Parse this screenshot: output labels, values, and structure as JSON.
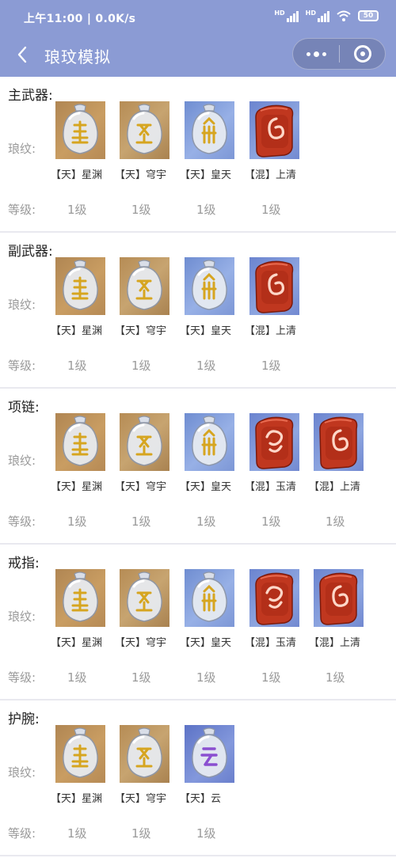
{
  "status": {
    "time": "上午11:00 | 0.0K/s",
    "hd1": "HD",
    "hd2": "HD",
    "battery": "50"
  },
  "nav": {
    "title": "琅玟模拟"
  },
  "labels": {
    "wen": "琅纹:",
    "level": "等级:"
  },
  "sections": [
    {
      "title": "主武器:",
      "items": [
        {
          "name": "【天】星渊",
          "level": "1级",
          "icon": "xingyuan-rune-icon"
        },
        {
          "name": "【天】穹宇",
          "level": "1级",
          "icon": "qiongyu-rune-icon"
        },
        {
          "name": "【天】皇天",
          "level": "1级",
          "icon": "huangtian-rune-icon"
        },
        {
          "name": "【混】上清",
          "level": "1级",
          "icon": "shangqing-rune-icon"
        }
      ]
    },
    {
      "title": "副武器:",
      "items": [
        {
          "name": "【天】星渊",
          "level": "1级",
          "icon": "xingyuan-rune-icon"
        },
        {
          "name": "【天】穹宇",
          "level": "1级",
          "icon": "qiongyu-rune-icon"
        },
        {
          "name": "【天】皇天",
          "level": "1级",
          "icon": "huangtian-rune-icon"
        },
        {
          "name": "【混】上清",
          "level": "1级",
          "icon": "shangqing-rune-icon"
        }
      ]
    },
    {
      "title": "项链:",
      "items": [
        {
          "name": "【天】星渊",
          "level": "1级",
          "icon": "xingyuan-rune-icon"
        },
        {
          "name": "【天】穹宇",
          "level": "1级",
          "icon": "qiongyu-rune-icon"
        },
        {
          "name": "【天】皇天",
          "level": "1级",
          "icon": "huangtian-rune-icon"
        },
        {
          "name": "【混】玉清",
          "level": "1级",
          "icon": "yuqing-rune-icon"
        },
        {
          "name": "【混】上清",
          "level": "1级",
          "icon": "shangqing-rune-icon"
        }
      ]
    },
    {
      "title": "戒指:",
      "items": [
        {
          "name": "【天】星渊",
          "level": "1级",
          "icon": "xingyuan-rune-icon"
        },
        {
          "name": "【天】穹宇",
          "level": "1级",
          "icon": "qiongyu-rune-icon"
        },
        {
          "name": "【天】皇天",
          "level": "1级",
          "icon": "huangtian-rune-icon"
        },
        {
          "name": "【混】玉清",
          "level": "1级",
          "icon": "yuqing-rune-icon"
        },
        {
          "name": "【混】上清",
          "level": "1级",
          "icon": "shangqing-rune-icon"
        }
      ]
    },
    {
      "title": "护腕:",
      "items": [
        {
          "name": "【天】星渊",
          "level": "1级",
          "icon": "xingyuan-rune-icon"
        },
        {
          "name": "【天】穹宇",
          "level": "1级",
          "icon": "qiongyu-rune-icon"
        },
        {
          "name": "【天】云",
          "level": "1级",
          "icon": "yun-rune-icon"
        }
      ]
    }
  ],
  "colors": {
    "header": "#8b9bd4",
    "text": "#222222",
    "muted": "#9a9a9a",
    "divider": "#e9e9ef",
    "hun_red": "#c0371f",
    "gold": "#d6a520",
    "purple": "#8a4fd0"
  }
}
